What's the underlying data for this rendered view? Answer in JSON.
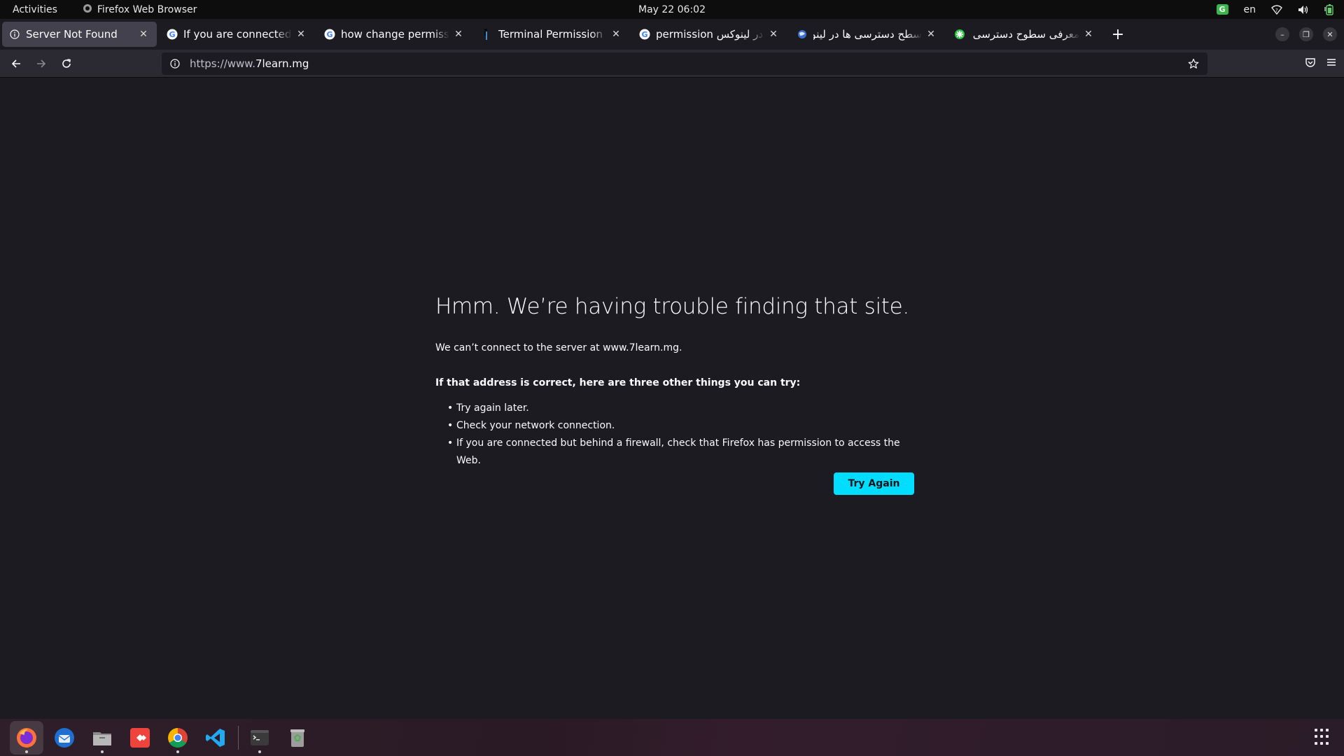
{
  "topbar": {
    "activities": "Activities",
    "app_name": "Firefox Web Browser",
    "clock": "May 22  06:02",
    "language": "en"
  },
  "tabs": [
    {
      "title": "Server Not Found",
      "icon": "info-icon",
      "active": true
    },
    {
      "title": "If you are connected but behind a firewall",
      "icon": "google-icon",
      "active": false
    },
    {
      "title": "how change permission in linux",
      "icon": "google-icon",
      "active": false
    },
    {
      "title": "Terminal Permission Denied",
      "icon": "terminal-favicon",
      "active": false
    },
    {
      "title": "permission در لینوکس - Google",
      "icon": "google-icon",
      "active": false
    },
    {
      "title": "سطح دسترسی ها در لینوکس",
      "icon": "globe-favicon",
      "active": false
    },
    {
      "title": "معرفی سطوح دسترسی ( )",
      "icon": "green-favicon",
      "active": false
    }
  ],
  "navbar": {
    "url_prefix": "https://www.",
    "url_domain": "7learn.mg"
  },
  "error": {
    "heading": "Hmm. We’re having trouble finding that site.",
    "description": "We can’t connect to the server at www.7learn.mg.",
    "lead": "If that address is correct, here are three other things you can try:",
    "suggestions": [
      "Try again later.",
      "Check your network connection.",
      "If you are connected but behind a firewall, check that Firefox has permission to access the Web."
    ],
    "button": "Try Again"
  },
  "dock": {
    "apps": [
      "firefox",
      "thunderbird",
      "files",
      "anydesk",
      "chrome",
      "vscode",
      "terminal",
      "trash"
    ]
  },
  "colors": {
    "page_bg": "#1c1b22",
    "toolbar_bg": "#2b2a33",
    "accent": "#00ddff",
    "active_tab": "#42414d"
  }
}
